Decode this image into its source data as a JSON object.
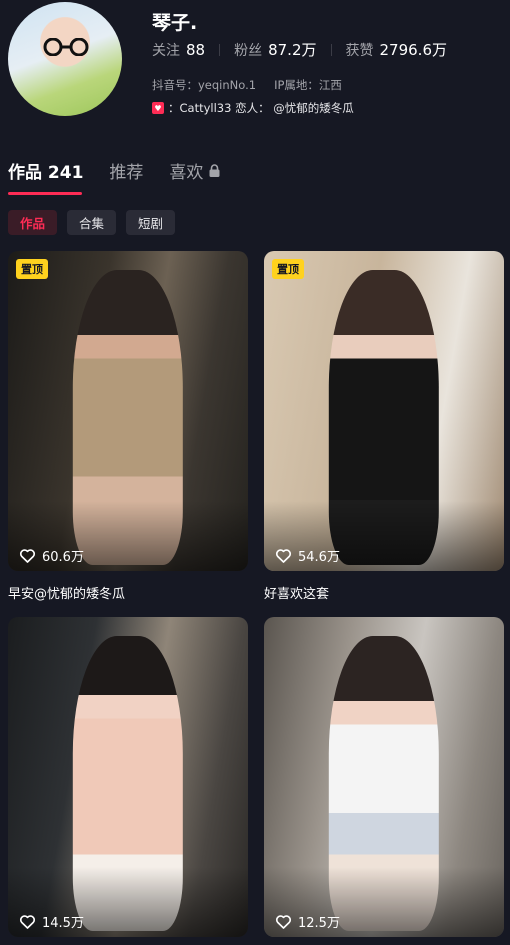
{
  "profile": {
    "name": "琴子.",
    "following_label": "关注",
    "following": "88",
    "followers_label": "粉丝",
    "followers": "87.2万",
    "likes_label": "获赞",
    "likes": "2796.6万",
    "douyin_id": "抖音号：yeqinNo.1",
    "ip_location": "IP属地：江西",
    "bio": "：Cattyll33 恋人： @忧郁的矮冬瓜"
  },
  "tabs": [
    {
      "label": "作品 241",
      "active": true
    },
    {
      "label": "推荐",
      "active": false
    },
    {
      "label": "喜欢",
      "active": false,
      "icon": "lock-icon"
    }
  ],
  "chips": [
    {
      "label": "作品",
      "active": true
    },
    {
      "label": "合集",
      "active": false
    },
    {
      "label": "短剧",
      "active": false
    }
  ],
  "videos": [
    {
      "pin": "置顶",
      "likes": "60.6万",
      "caption": "早安@忧郁的矮冬瓜"
    },
    {
      "pin": "置顶",
      "likes": "54.6万",
      "caption": "好喜欢这套"
    },
    {
      "pin": "",
      "likes": "14.5万",
      "caption": ""
    },
    {
      "pin": "",
      "likes": "12.5万",
      "caption": ""
    }
  ],
  "colors": {
    "background": "#161823",
    "accent": "#fe2c55",
    "pin_badge": "#ffd21e",
    "muted_text": "#a3a4aa"
  }
}
